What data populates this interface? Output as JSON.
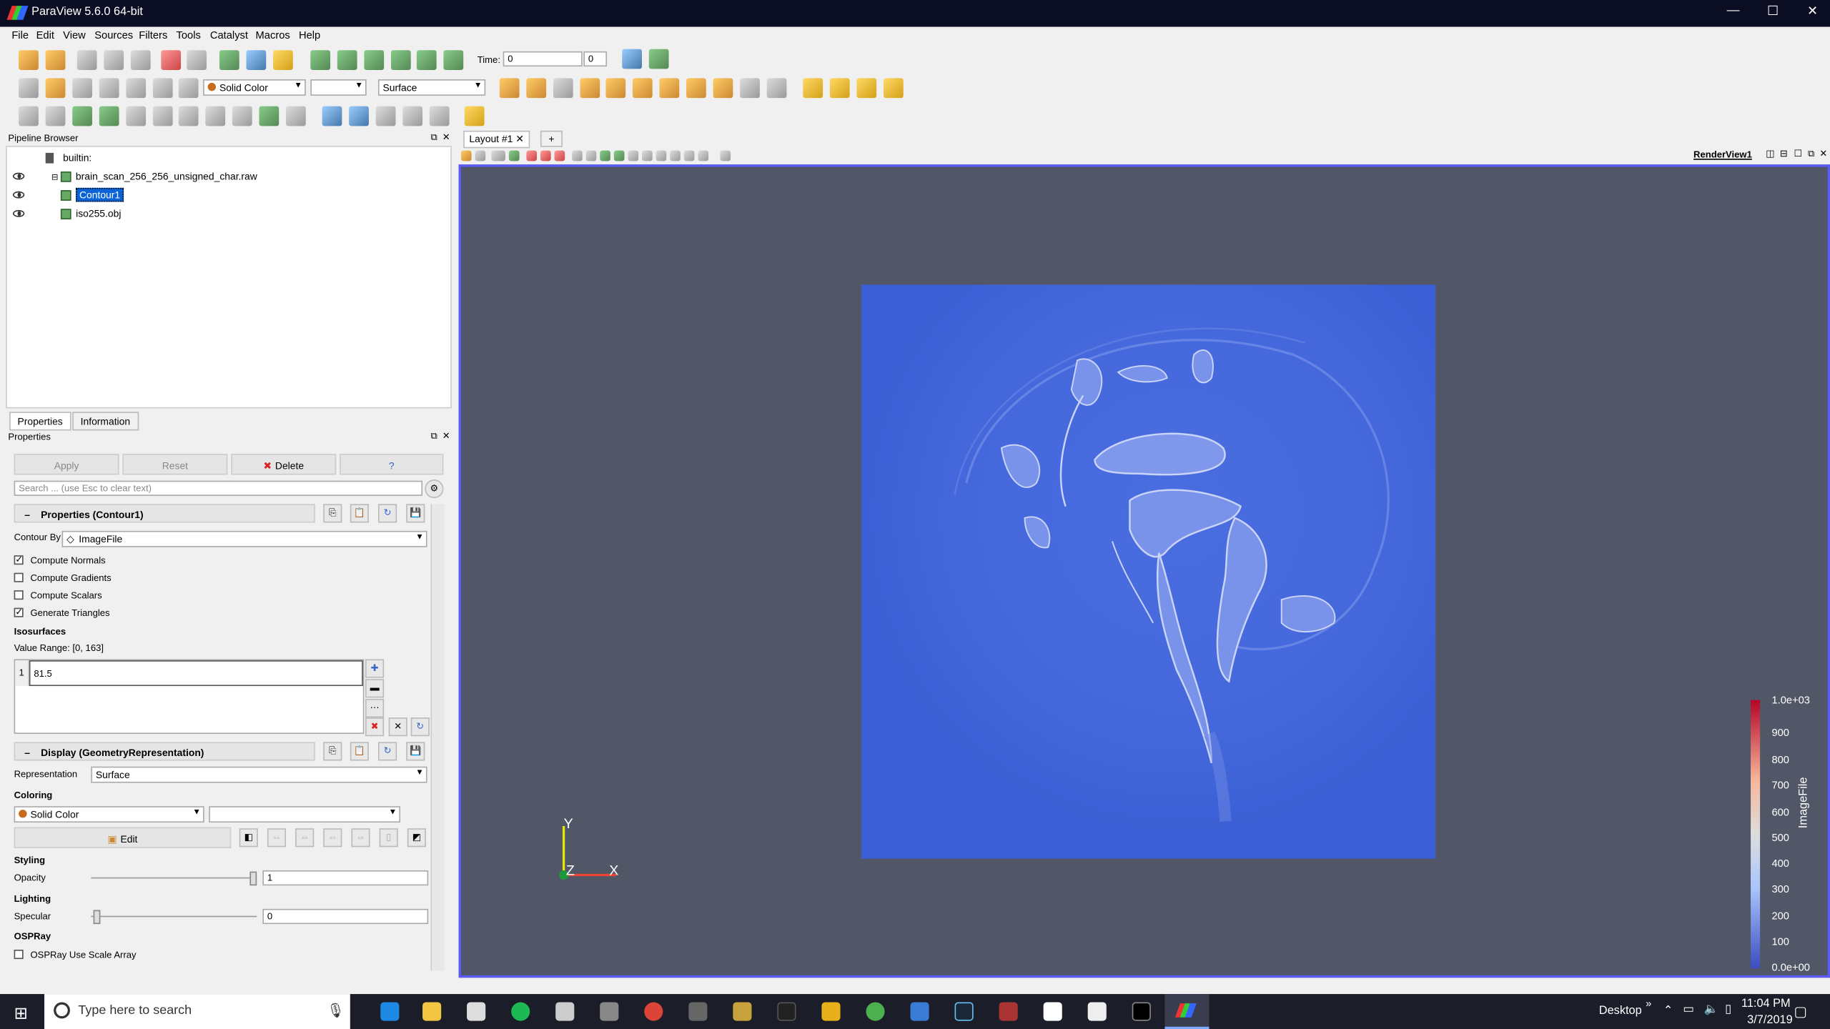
{
  "window": {
    "title": "ParaView 5.6.0 64-bit",
    "minimize": "—",
    "maximize": "☐",
    "close": "✕"
  },
  "menubar": [
    "File",
    "Edit",
    "View",
    "Sources",
    "Filters",
    "Tools",
    "Catalyst",
    "Macros",
    "Help"
  ],
  "toolbar": {
    "time_label": "Time:",
    "time_value": "0",
    "time_index": "0",
    "coloring_combo": "Solid Color",
    "representation_combo": "Surface"
  },
  "pipeline_browser": {
    "title": "Pipeline Browser",
    "items": [
      {
        "label": "builtin:"
      },
      {
        "label": "brain_scan_256_256_unsigned_char.raw"
      },
      {
        "label": "Contour1",
        "selected": true
      },
      {
        "label": "iso255.obj"
      }
    ]
  },
  "tabs": {
    "properties": "Properties",
    "information": "Information"
  },
  "properties": {
    "title": "Properties",
    "apply": "Apply",
    "reset": "Reset",
    "delete": "Delete",
    "help": "?",
    "search_placeholder": "Search ... (use Esc to clear text)",
    "section_props": "Properties (Contour1)",
    "contour_by_label": "Contour By",
    "contour_by_value": "ImageFile",
    "checks": [
      {
        "label": "Compute Normals",
        "checked": true
      },
      {
        "label": "Compute Gradients",
        "checked": false
      },
      {
        "label": "Compute Scalars",
        "checked": false
      },
      {
        "label": "Generate Triangles",
        "checked": true
      }
    ],
    "isosurfaces_label": "Isosurfaces",
    "value_range": "Value Range: [0, 163]",
    "iso_index": "1",
    "iso_value": "81.5",
    "section_display": "Display (GeometryRepresentation)",
    "representation_label": "Representation",
    "representation_value": "Surface",
    "coloring_label": "Coloring",
    "coloring_value": "Solid Color",
    "edit": "Edit",
    "styling_label": "Styling",
    "opacity_label": "Opacity",
    "opacity_value": "1",
    "lighting_label": "Lighting",
    "specular_label": "Specular",
    "specular_value": "0",
    "ospray_label": "OSPRay",
    "ospray_scale": "OSPRay Use Scale Array"
  },
  "layout": {
    "tab": "Layout #1",
    "add": "+",
    "view_name": "RenderView1"
  },
  "axes": {
    "y": "Y",
    "z": "Z",
    "x": "X"
  },
  "legend": {
    "title": "ImageFile",
    "ticks": [
      "1.0e+03",
      "900",
      "800",
      "700",
      "600",
      "500",
      "400",
      "300",
      "200",
      "100",
      "0.0e+00"
    ],
    "colors": {
      "high": "#b40426",
      "mid": "#dddddd",
      "low": "#3b4cc0"
    }
  },
  "taskbar": {
    "search_placeholder": "Type here to search",
    "desktop": "Desktop",
    "time": "11:04 PM",
    "date": "3/7/2019"
  }
}
